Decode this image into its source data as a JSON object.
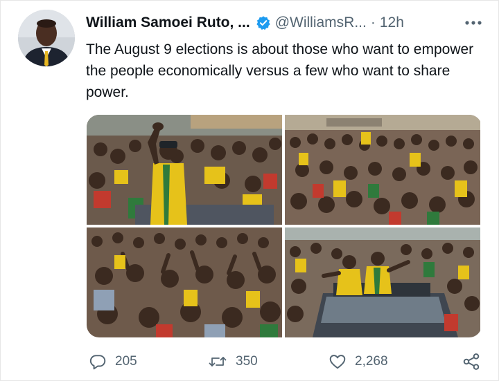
{
  "tweet": {
    "author_name": "William Samoei Ruto, ...",
    "handle": "@WilliamsR...",
    "separator": "·",
    "time": "12h",
    "text": "The August 9 elections is about those who want to empower the people economically versus a few who want to share power.",
    "verified": true
  },
  "media": {
    "photos": [
      {
        "icon": "rally-photo-speaker"
      },
      {
        "icon": "rally-photo-crowd"
      },
      {
        "icon": "rally-photo-crowd-waving"
      },
      {
        "icon": "rally-photo-car-sunroof"
      }
    ]
  },
  "actions": {
    "reply_count": "205",
    "retweet_count": "350",
    "like_count": "2,268"
  },
  "colors": {
    "text_primary": "#0f1419",
    "text_secondary": "#536471",
    "verified_blue": "#1d9bf0",
    "campaign_yellow": "#f2c811"
  }
}
